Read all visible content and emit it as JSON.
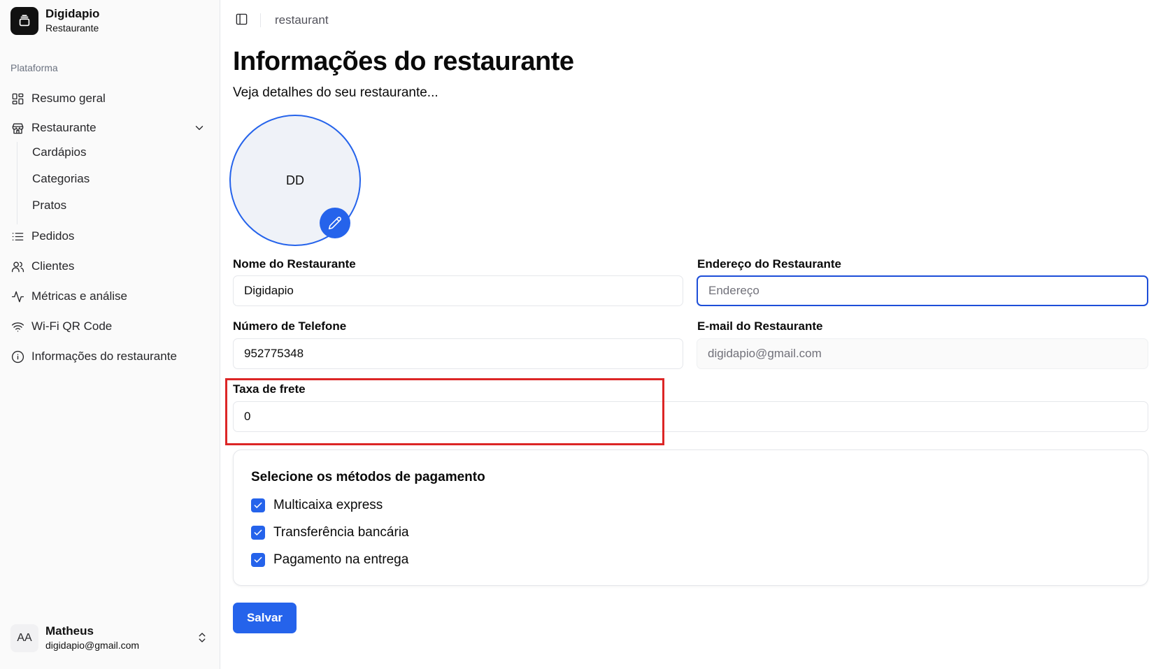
{
  "brand": {
    "name": "Digidapio",
    "subtitle": "Restaurante"
  },
  "sidebar": {
    "group_label": "Plataforma",
    "items": [
      {
        "label": "Resumo geral",
        "icon": "layout-grid-icon"
      },
      {
        "label": "Restaurante",
        "icon": "store-icon",
        "expanded": true
      },
      {
        "label": "Pedidos",
        "icon": "list-icon"
      },
      {
        "label": "Clientes",
        "icon": "users-icon"
      },
      {
        "label": "Métricas e análise",
        "icon": "activity-icon"
      },
      {
        "label": "Wi-Fi QR Code",
        "icon": "wifi-icon"
      },
      {
        "label": "Informações do restaurante",
        "icon": "info-icon"
      }
    ],
    "sub_items": [
      {
        "label": "Cardápios"
      },
      {
        "label": "Categorias"
      },
      {
        "label": "Pratos"
      }
    ]
  },
  "user": {
    "initials": "AA",
    "name": "Matheus",
    "email": "digidapio@gmail.com"
  },
  "header": {
    "breadcrumb": "restaurant"
  },
  "page": {
    "title": "Informações do restaurante",
    "subtitle": "Veja detalhes do seu restaurante..."
  },
  "logo": {
    "initials": "DD"
  },
  "form": {
    "name": {
      "label": "Nome do Restaurante",
      "value": "Digidapio"
    },
    "address": {
      "label": "Endereço do Restaurante",
      "value": "",
      "placeholder": "Endereço"
    },
    "phone": {
      "label": "Número de Telefone",
      "value": "952775348"
    },
    "email": {
      "label": "E-mail do Restaurante",
      "value": "",
      "placeholder": "digidapio@gmail.com"
    },
    "delivery_fee": {
      "label": "Taxa de frete",
      "value": "0"
    }
  },
  "payment": {
    "title": "Selecione os métodos de pagamento",
    "options": [
      {
        "label": "Multicaixa express",
        "checked": true
      },
      {
        "label": "Transferência bancária",
        "checked": true
      },
      {
        "label": "Pagamento na entrega",
        "checked": true
      }
    ]
  },
  "actions": {
    "save_label": "Salvar"
  },
  "colors": {
    "accent": "#2563eb",
    "highlight": "#dc2626",
    "sidebar_bg": "#fafafa"
  }
}
